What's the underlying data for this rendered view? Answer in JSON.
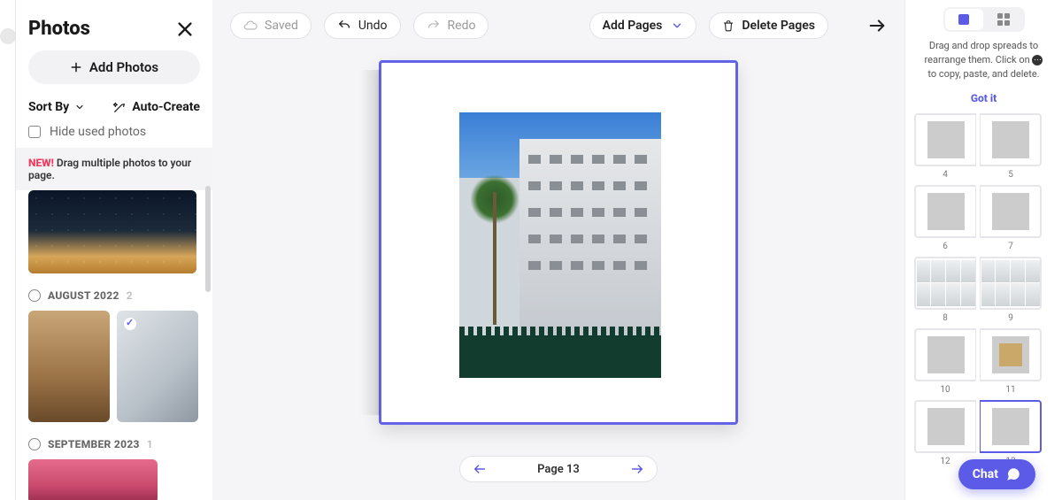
{
  "colors": {
    "accent": "#5b5be8",
    "danger": "#f4365a"
  },
  "sidebar": {
    "title": "Photos",
    "add_photos": "Add Photos",
    "sort_by": "Sort By",
    "auto_create": "Auto-Create",
    "hide_used": "Hide used photos",
    "tip_new": "NEW!",
    "tip_rest": "Drag multiple photos to your page.",
    "groups": [
      {
        "name": "AUGUST 2022",
        "count": "2"
      },
      {
        "name": "SEPTEMBER 2023",
        "count": "1"
      }
    ]
  },
  "toolbar": {
    "saved": "Saved",
    "undo": "Undo",
    "redo": "Redo",
    "add_pages": "Add Pages",
    "delete_pages": "Delete Pages"
  },
  "page": {
    "label": "Page 13"
  },
  "rightbar": {
    "tip_line1": "Drag and drop spreads to",
    "tip_line2": "rearrange them. Click on",
    "tip_line3": "to copy, paste, and delete.",
    "got_it": "Got it",
    "spreads": [
      {
        "left": "4",
        "right": "5"
      },
      {
        "left": "6",
        "right": "7"
      },
      {
        "left": "8",
        "right": "9"
      },
      {
        "left": "10",
        "right": "11"
      },
      {
        "left": "12",
        "right": "13"
      }
    ]
  },
  "chat": {
    "label": "Chat"
  }
}
